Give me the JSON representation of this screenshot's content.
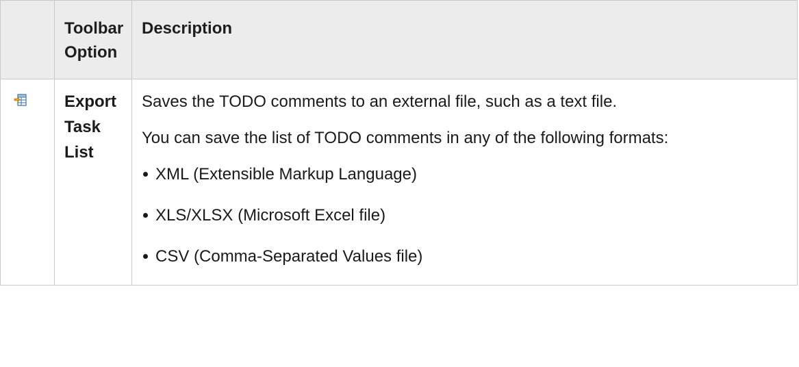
{
  "table": {
    "headers": {
      "icon": "",
      "option": "Toolbar Option",
      "description": "Description"
    },
    "row": {
      "icon": "export-task-list-icon",
      "option": "Export Task List",
      "paragraphs": [
        "Saves the TODO comments to an external file, such as a text file.",
        "You can save the list of TODO comments in any of the following formats:"
      ],
      "formats": [
        "XML (Extensible Markup Language)",
        "XLS/XLSX (Microsoft Excel file)",
        "CSV (Comma-Separated Values file)"
      ]
    }
  },
  "colors": {
    "header_bg": "#ececec",
    "border": "#c8c8c8",
    "icon_accent": "#e0a020",
    "icon_grid": "#3a6ea5"
  }
}
